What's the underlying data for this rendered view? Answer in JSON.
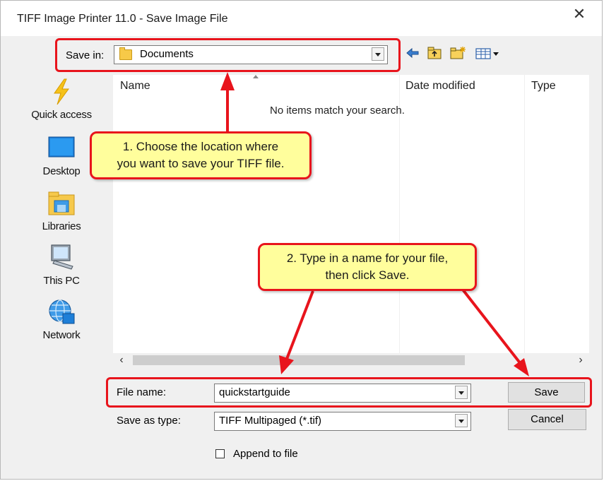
{
  "window": {
    "title": "TIFF Image Printer 11.0 - Save Image File",
    "close_glyph": "✕"
  },
  "toolbar": {
    "save_in_label": "Save in:",
    "save_in_value": "Documents",
    "icons": [
      "back-arrow-icon",
      "up-folder-icon",
      "new-folder-icon",
      "view-menu-icon"
    ]
  },
  "sidebar": {
    "items": [
      {
        "label": "Quick access",
        "icon": "quick-access-icon"
      },
      {
        "label": "Desktop",
        "icon": "desktop-icon"
      },
      {
        "label": "Libraries",
        "icon": "libraries-icon"
      },
      {
        "label": "This PC",
        "icon": "this-pc-icon"
      },
      {
        "label": "Network",
        "icon": "network-icon"
      }
    ]
  },
  "filelist": {
    "columns": [
      "Name",
      "Date modified",
      "Type"
    ],
    "empty_message": "No items match your search."
  },
  "form": {
    "file_name_label": "File name:",
    "file_name_value": "quickstartguide",
    "save_as_type_label": "Save as type:",
    "save_as_type_value": "TIFF Multipaged (*.tif)",
    "save_button": "Save",
    "cancel_button": "Cancel",
    "append_label": "Append to file",
    "append_checked": false
  },
  "annotations": {
    "callout1": [
      "1. Choose the location where",
      "you want to save your TIFF file."
    ],
    "callout2": [
      "2. Type in a name for your file,",
      "then click Save."
    ],
    "highlight_color": "#e8141c",
    "callout_color": "#fffe9c"
  }
}
